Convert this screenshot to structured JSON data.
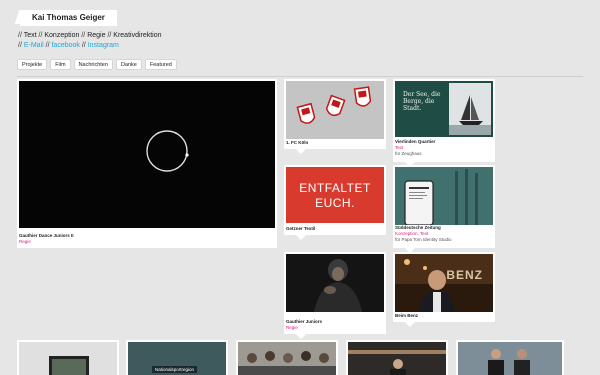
{
  "header": {
    "title": "Kai Thomas Geiger"
  },
  "roles": [
    "Text",
    "Konzeption",
    "Regie",
    "Kreativdirektion"
  ],
  "links": [
    "E-Mail",
    "facebook",
    "Instagram"
  ],
  "nav": [
    "Projekte",
    "Film",
    "Nachrichten",
    "Danke",
    "Featured"
  ],
  "cards": [
    {
      "title": "Gauthier Dance Juniors II",
      "role": "Regie"
    },
    {
      "title": "1. FC Köln"
    },
    {
      "title": "Vierlinden Quartier",
      "role": "Text",
      "client": "für Zeughaus",
      "poster_text": "Der See, die Berge, die Stadt."
    },
    {
      "title": "Getzner Textil",
      "poster_text": "ENTFALTET EUCH."
    },
    {
      "title": "Süddeutsche Zeitung",
      "role": "Konzeption, Text",
      "client": "für Papa Tom Identity Studio"
    },
    {
      "title": "Gauthier Juniors",
      "role": "Regie"
    },
    {
      "title": "Beim Benz",
      "overlay_text": "BENZ"
    },
    {
      "overlay_text": "Nationalsportregion"
    }
  ],
  "colors": {
    "accent_link": "#1ea7d8",
    "role_pink": "#e0197d",
    "background": "#e6e6e6"
  }
}
